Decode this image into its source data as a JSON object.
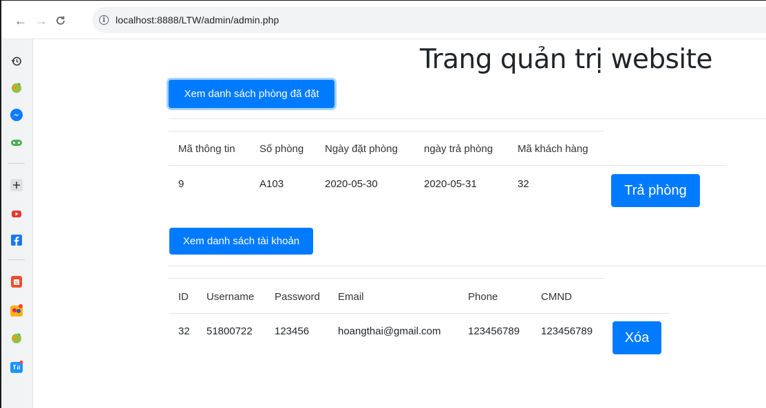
{
  "browser": {
    "url": "localhost:8888/LTW/admin/admin.php",
    "back_glyph": "←",
    "forward_glyph": "→",
    "reload_glyph": "C",
    "info_glyph": "i"
  },
  "sidebar": {
    "icons": [
      "history-icon",
      "browser-extension-icon",
      "messenger-icon",
      "games-icon",
      "add-icon",
      "youtube-icon",
      "facebook-icon",
      "shopee-icon",
      "game-app-icon",
      "browser-extension-icon-2",
      "tiki-icon"
    ]
  },
  "page": {
    "title": "Trang quản trị website",
    "rooms_button": "Xem danh sách phòng đã đặt",
    "accounts_button": "Xem danh sách tài khoản",
    "checkout_button": "Trả phòng",
    "delete_button": "Xóa"
  },
  "bookings": {
    "headers": [
      "Mã thông tin",
      "Số phòng",
      "Ngày đặt phòng",
      "ngày trả phòng",
      "Mã khách hàng"
    ],
    "rows": [
      [
        "9",
        "A103",
        "2020-05-30",
        "2020-05-31",
        "32"
      ]
    ]
  },
  "accounts": {
    "headers": [
      "ID",
      "Username",
      "Password",
      "Email",
      "Phone",
      "CMND"
    ],
    "rows": [
      [
        "32",
        "51800722",
        "123456",
        "hoangthai@gmail.com",
        "123456789",
        "123456789"
      ]
    ]
  },
  "colors": {
    "primary": "#007bff",
    "sidebar_bg": "#f1f3f4"
  }
}
